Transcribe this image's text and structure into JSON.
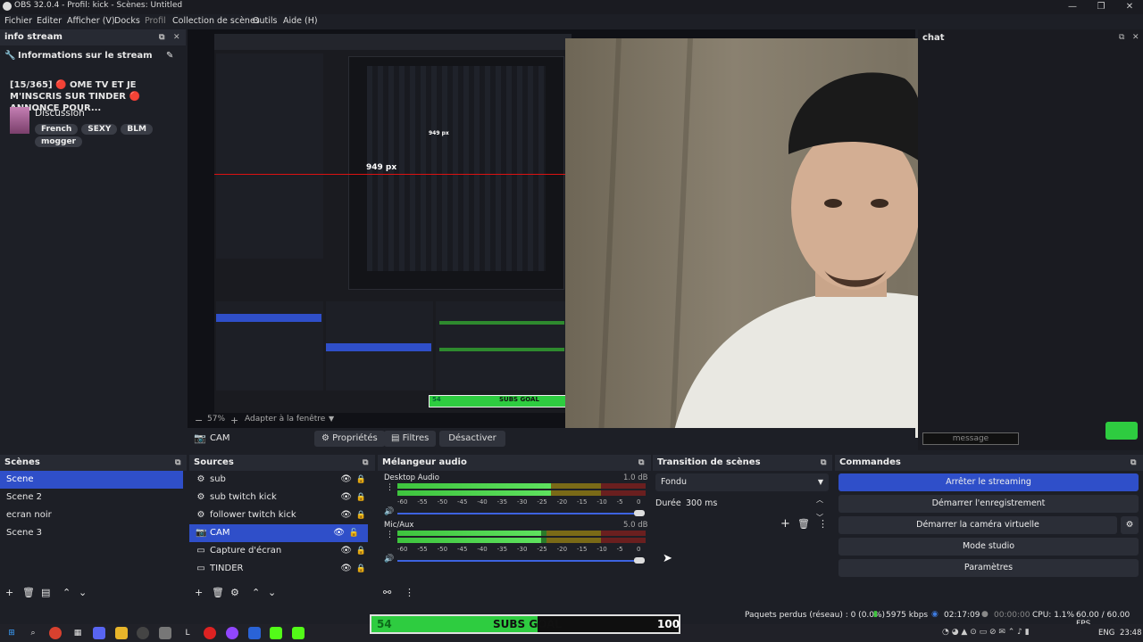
{
  "window": {
    "title": "OBS 32.0.4 - Profil: kick - Scènes: Untitled"
  },
  "menu": [
    "Fichier",
    "Editer",
    "Afficher (V)",
    "Docks",
    "Profil",
    "Collection de scènes",
    "Outils",
    "Aide (H)"
  ],
  "info": {
    "dock_title": "info stream",
    "header": "Informations sur le stream",
    "stream_title": "[15/365] 🔴 OME TV ET JE M'INSCRIS SUR TINDER 🔴 ANNONCE POUR...",
    "category": "Discussion",
    "tags": [
      "French",
      "SEXY",
      "BLM",
      "mogger"
    ]
  },
  "preview": {
    "nested_px_label": "949 px",
    "nested_px_label_small": "949 px",
    "zoom": "57%",
    "fit": "Adapter à la fenêtre",
    "nested_goal_left": "54",
    "nested_goal_mid": "SUBS GOAL"
  },
  "source_toolbar": {
    "name": "CAM",
    "properties": "Propriétés",
    "filters": "Filtres",
    "deactivate": "Désactiver"
  },
  "chat": {
    "title": "chat",
    "message_placeholder": "message"
  },
  "scenes": {
    "title": "Scènes",
    "items": [
      "Scene",
      "Scene 2",
      "ecran noir",
      "Scene 3"
    ]
  },
  "sources": {
    "title": "Sources",
    "items": [
      "sub",
      "sub twitch kick",
      "follower twitch kick",
      "CAM",
      "Capture d'écran",
      "TINDER"
    ]
  },
  "mixer": {
    "title": "Mélangeur audio",
    "channels": [
      {
        "name": "Desktop Audio",
        "db": "1.0 dB",
        "level": 0.62
      },
      {
        "name": "Mic/Aux",
        "db": "5.0 dB",
        "level": 0.58
      }
    ],
    "scale": [
      "-60",
      "-55",
      "-50",
      "-45",
      "-40",
      "-35",
      "-30",
      "-25",
      "-20",
      "-15",
      "-10",
      "-5",
      "0"
    ]
  },
  "transition": {
    "title": "Transition de scènes",
    "type": "Fondu",
    "duration_label": "Durée",
    "duration": "300 ms"
  },
  "controls": {
    "title": "Commandes",
    "stop_stream": "Arrêter le streaming",
    "start_record": "Démarrer l'enregistrement",
    "start_vcam": "Démarrer la caméra virtuelle",
    "studio": "Mode studio",
    "settings": "Paramètres"
  },
  "status": {
    "dropped": "Paquets perdus (réseau) : 0 (0.0%)",
    "bitrate": "5975 kbps",
    "stream_time": "02:17:09",
    "rec_time": "00:00:00",
    "cpu": "CPU: 1.1%",
    "fps": "60.00 / 60.00 FPS"
  },
  "goal": {
    "current": "54",
    "label": "SUBS GOAL",
    "target": "100",
    "fraction": 0.54
  },
  "taskbar": {
    "lang": "ENG",
    "time": "23:48"
  },
  "colors": {
    "accent": "#2f4fc9",
    "meter_green": "#3ec43e",
    "goal_green": "#2ecc40"
  }
}
